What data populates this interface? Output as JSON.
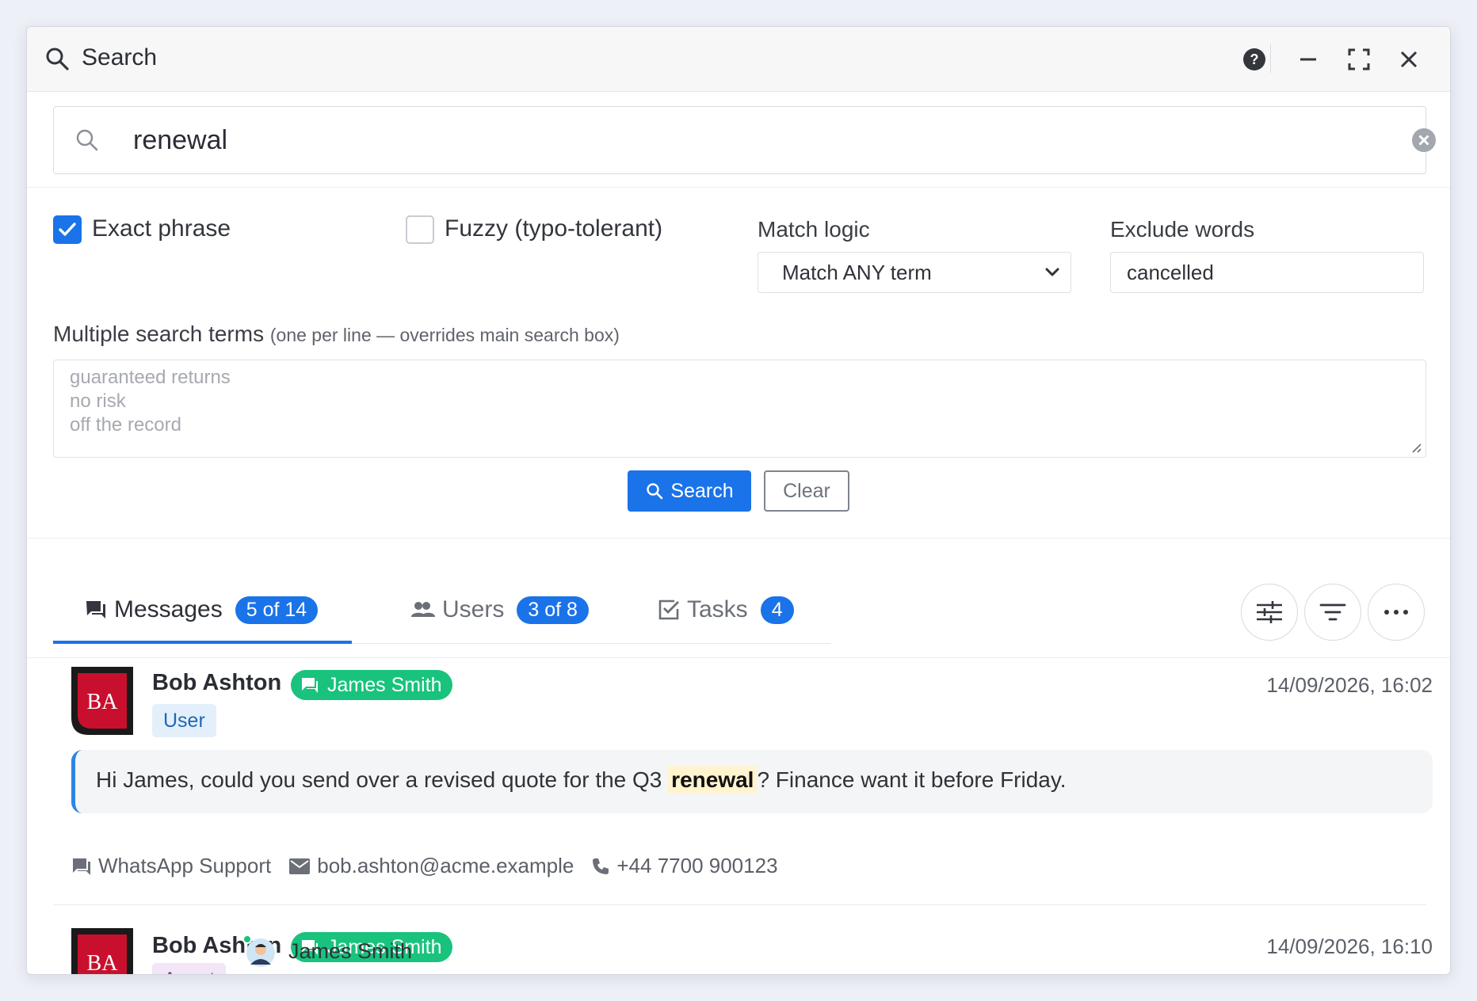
{
  "window": {
    "title": "Search"
  },
  "search": {
    "value": "renewal"
  },
  "options": {
    "exact_phrase": {
      "label": "Exact phrase",
      "checked": true
    },
    "fuzzy": {
      "label": "Fuzzy (typo-tolerant)",
      "checked": false
    },
    "match_logic": {
      "label": "Match logic",
      "selected": "Match ANY term"
    },
    "exclude_words": {
      "label": "Exclude words",
      "value": "cancelled"
    }
  },
  "multi_terms": {
    "label": "Multiple search terms",
    "hint": "(one per line — overrides main search box)",
    "placeholder_lines": [
      "guaranteed returns",
      "no risk",
      "off the record"
    ]
  },
  "actions": {
    "search_label": "Search",
    "clear_label": "Clear"
  },
  "tabs": [
    {
      "label": "Messages",
      "badge": "5 of 14",
      "active": true
    },
    {
      "label": "Users",
      "badge": "3 of 8",
      "active": false
    },
    {
      "label": "Tasks",
      "badge": "4",
      "active": false
    }
  ],
  "messages": [
    {
      "initials": "BA",
      "sender": "Bob Ashton",
      "channel_contact": "James Smith",
      "role": "User",
      "time": "14/09/2026, 16:02",
      "text_before": "Hi James, could you send over a revised quote for the Q3",
      "highlight": "renewal",
      "text_after": "? Finance want it before Friday.",
      "channel": "WhatsApp Support",
      "email": "bob.ashton@acme.example",
      "phone": "+44 7700 900123"
    },
    {
      "initials": "BA",
      "sender": "Bob Ashton",
      "channel_contact": "James Smith",
      "role": "Agent",
      "agent_name": "James Smith",
      "time": "14/09/2026, 16:10"
    }
  ],
  "colors": {
    "accent": "#1a73e8",
    "channel_green": "#19c37d",
    "avatar_red": "#c8102e"
  }
}
